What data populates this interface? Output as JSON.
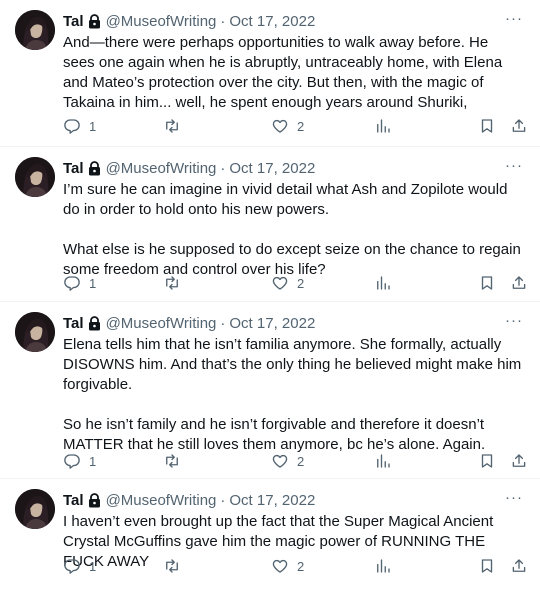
{
  "tweets": [
    {
      "name": "Tal",
      "handle": "@MuseofWriting",
      "separator": "·",
      "date": "Oct 17, 2022",
      "more": "···",
      "paragraphs": [
        "And—there were perhaps opportunities to walk away before. He sees one again when he is abruptly, untraceably home, with Elena and Mateo’s protection over the city. But then, with the magic of Takaina in him... well, he spent enough years around Shuriki,"
      ],
      "replies": "1",
      "retweets": "",
      "likes": "2"
    },
    {
      "name": "Tal",
      "handle": "@MuseofWriting",
      "separator": "·",
      "date": "Oct 17, 2022",
      "more": "···",
      "paragraphs": [
        "I’m sure he can imagine in vivid detail what Ash and Zopilote would do in order to hold onto his new powers.",
        "What else is he supposed to do except seize on the chance to regain some freedom and control over his life?"
      ],
      "replies": "1",
      "retweets": "",
      "likes": "2"
    },
    {
      "name": "Tal",
      "handle": "@MuseofWriting",
      "separator": "·",
      "date": "Oct 17, 2022",
      "more": "···",
      "paragraphs": [
        "Elena tells him that he isn’t familia anymore. She formally, actually DISOWNS him. And that’s the only thing he believed might make him forgivable.",
        "So he isn’t family and he isn’t forgivable and therefore it doesn’t MATTER that he still loves them anymore, bc he’s alone. Again."
      ],
      "replies": "1",
      "retweets": "",
      "likes": "2"
    },
    {
      "name": "Tal",
      "handle": "@MuseofWriting",
      "separator": "·",
      "date": "Oct 17, 2022",
      "more": "···",
      "paragraphs": [
        "I haven’t even brought up the fact that the Super Magical Ancient Crystal McGuffins gave him the magic power of RUNNING THE FUCK AWAY"
      ],
      "replies": "1",
      "retweets": "",
      "likes": "2"
    }
  ],
  "icons": {
    "reply": "reply-icon",
    "retweet": "retweet-icon",
    "like": "heart-icon",
    "views": "views-icon",
    "bookmark": "bookmark-icon",
    "share": "share-icon",
    "lock": "lock-icon"
  },
  "colors": {
    "text": "#0f1419",
    "secondary": "#536471",
    "divider": "#eff3f4"
  }
}
